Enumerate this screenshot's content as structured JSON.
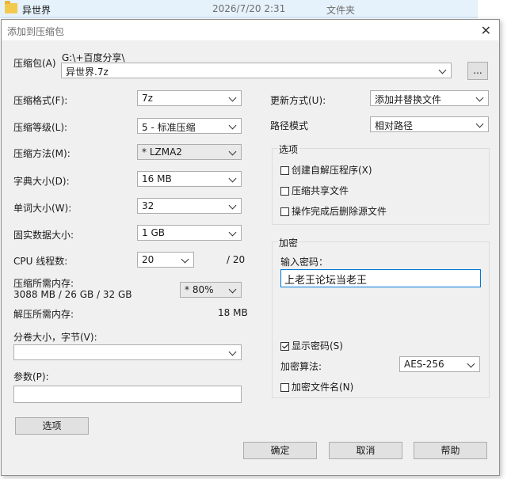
{
  "explorer_row": {
    "name": "异世界",
    "date": "2026/7/20 2:31",
    "type": "文件夹"
  },
  "dialog": {
    "title": "添加到压缩包",
    "archive_label": "压缩包(A)",
    "archive_path": "G:\\+百度分享\\",
    "archive_name": "异世界.7z",
    "browse_label": "...",
    "format_label": "压缩格式(F):",
    "format_value": "7z",
    "level_label": "压缩等级(L):",
    "level_value": "5 - 标准压缩",
    "method_label": "压缩方法(M):",
    "method_value": "*  LZMA2",
    "dict_label": "字典大小(D):",
    "dict_value": "16 MB",
    "word_label": "单词大小(W):",
    "word_value": "32",
    "solid_label": "固实数据大小:",
    "solid_value": "1 GB",
    "cpu_label": "CPU 线程数:",
    "cpu_value": "20",
    "cpu_max": "/ 20",
    "mem_comp_label": "压缩所需内存:",
    "mem_comp_value": "3088 MB / 26 GB / 32 GB",
    "mem_percent": "* 80%",
    "mem_decomp_label": "解压所需内存:",
    "mem_decomp_value": "18 MB",
    "split_label": "分卷大小，字节(V):",
    "split_value": "",
    "params_label": "参数(P):",
    "params_value": "",
    "options_button": "选项",
    "update_label": "更新方式(U):",
    "update_value": "添加并替换文件",
    "path_label": "路径模式",
    "path_value": "相对路径",
    "options_group": {
      "title": "选项",
      "sfx": "创建自解压程序(X)",
      "shared": "压缩共享文件",
      "delete": "操作完成后删除源文件"
    },
    "encrypt_group": {
      "title": "加密",
      "pwd_label": "输入密码：",
      "pwd_value": "上老王论坛当老王",
      "show_pwd": "显示密码(S)",
      "algo_label": "加密算法:",
      "algo_value": "AES-256",
      "encrypt_names": "加密文件名(N)"
    },
    "ok": "确定",
    "cancel": "取消",
    "help": "帮助"
  }
}
